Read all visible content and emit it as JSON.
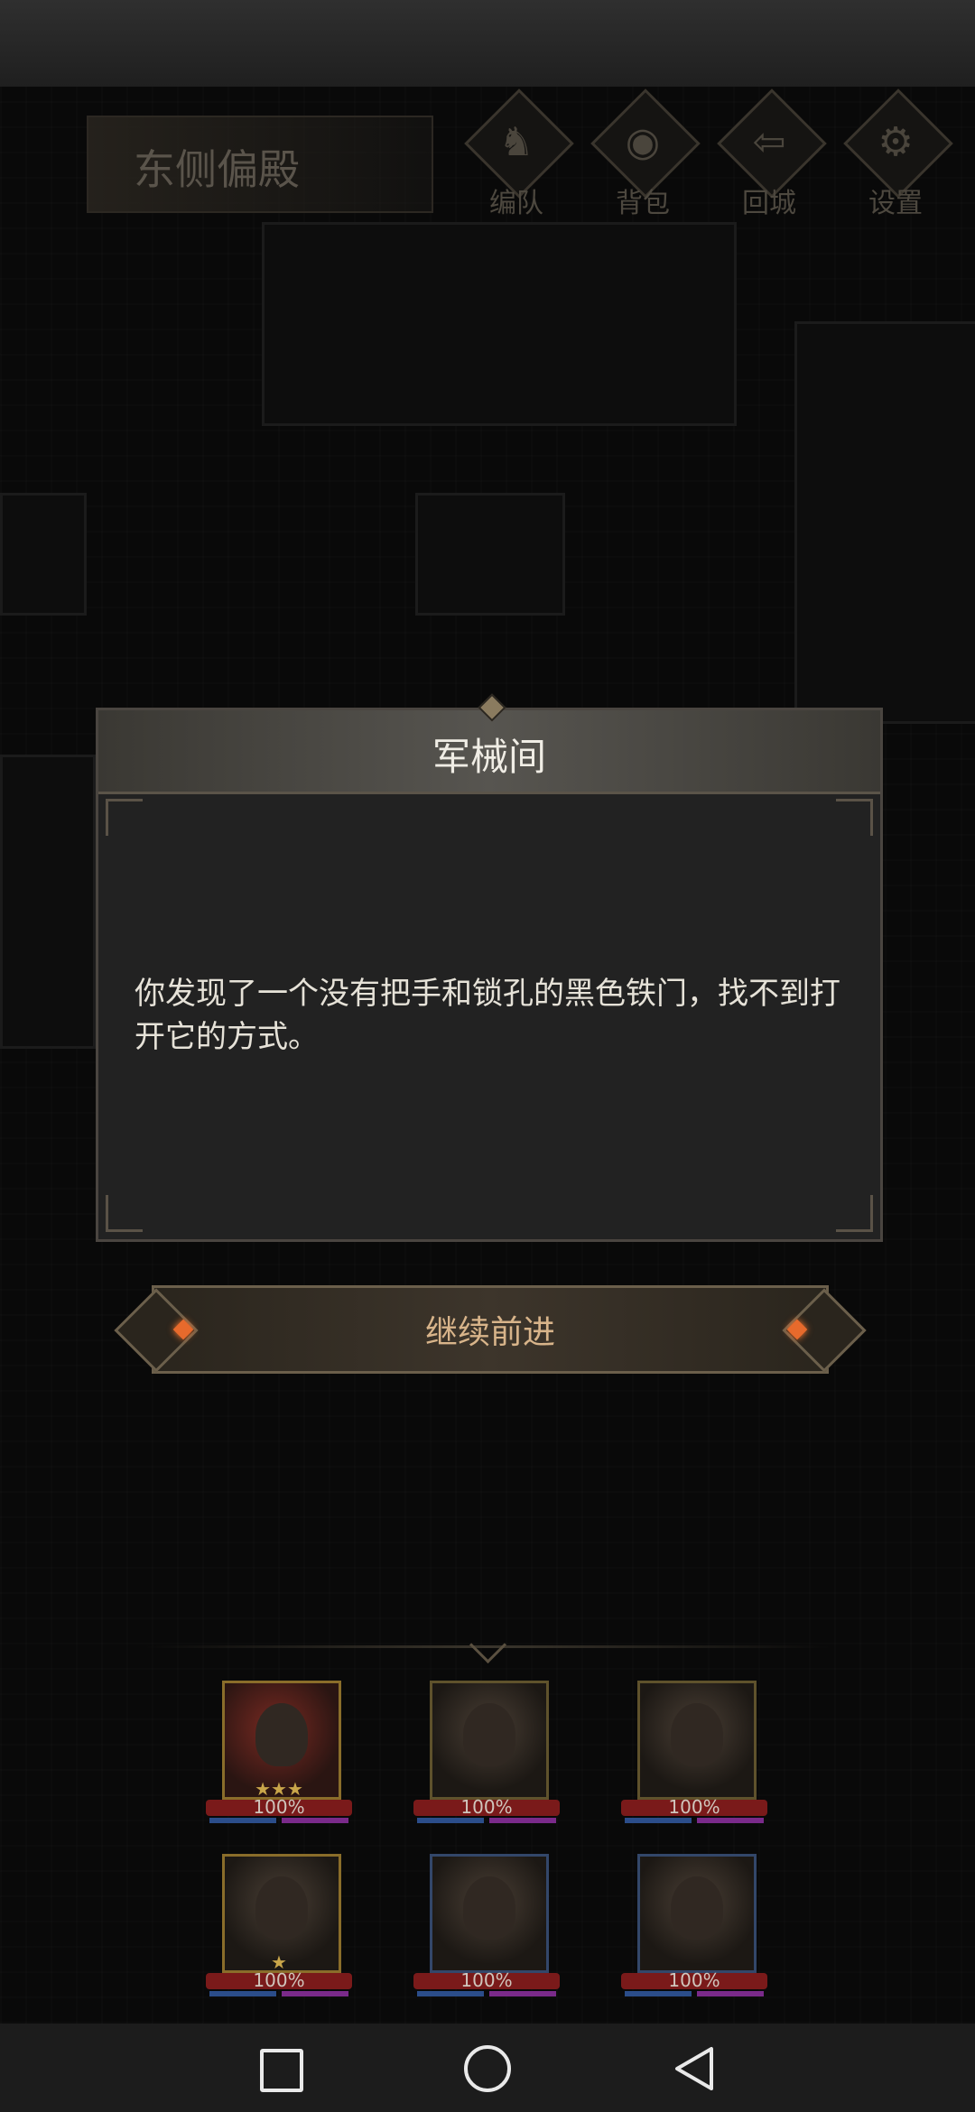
{
  "location": {
    "title": "东侧偏殿"
  },
  "menu": [
    {
      "label": "编队",
      "icon": "team-icon"
    },
    {
      "label": "背包",
      "icon": "bag-icon"
    },
    {
      "label": "回城",
      "icon": "return-town-icon"
    },
    {
      "label": "设置",
      "icon": "gear-icon"
    }
  ],
  "dialog": {
    "title": "军械间",
    "body": "你发现了一个没有把手和锁孔的黑色铁门，找不到打开它的方式。"
  },
  "continue_button": {
    "label": "继续前进"
  },
  "party": {
    "heroes": [
      {
        "hp": "100%",
        "stars": "★★★"
      },
      {
        "hp": "100%",
        "stars": ""
      },
      {
        "hp": "100%",
        "stars": ""
      },
      {
        "hp": "100%",
        "stars": "★"
      },
      {
        "hp": "100%",
        "stars": ""
      },
      {
        "hp": "100%",
        "stars": ""
      }
    ]
  },
  "nav": {
    "recent_icon": "square-icon",
    "home_icon": "circle-icon",
    "back_icon": "triangle-back-icon"
  }
}
